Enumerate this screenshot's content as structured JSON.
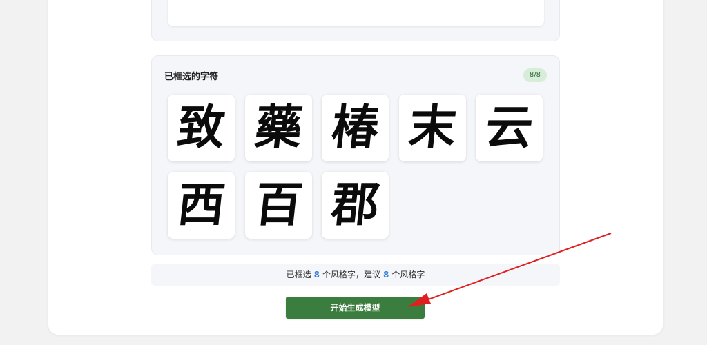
{
  "selected_panel": {
    "title": "已框选的字符",
    "count_badge": "8/8",
    "characters": [
      {
        "char": "致"
      },
      {
        "char": "藥"
      },
      {
        "char": "椿"
      },
      {
        "char": "末"
      },
      {
        "char": "云"
      },
      {
        "char": "西"
      },
      {
        "char": "百"
      },
      {
        "char": "郡"
      }
    ]
  },
  "info_bar": {
    "prefix": "已框选",
    "selected_count": "8",
    "middle": "个风格字，建议",
    "suggested_count": "8",
    "suffix": "个风格字"
  },
  "start_button": {
    "label": "开始生成模型"
  },
  "annotation": {
    "arrow_color": "#e02020"
  }
}
